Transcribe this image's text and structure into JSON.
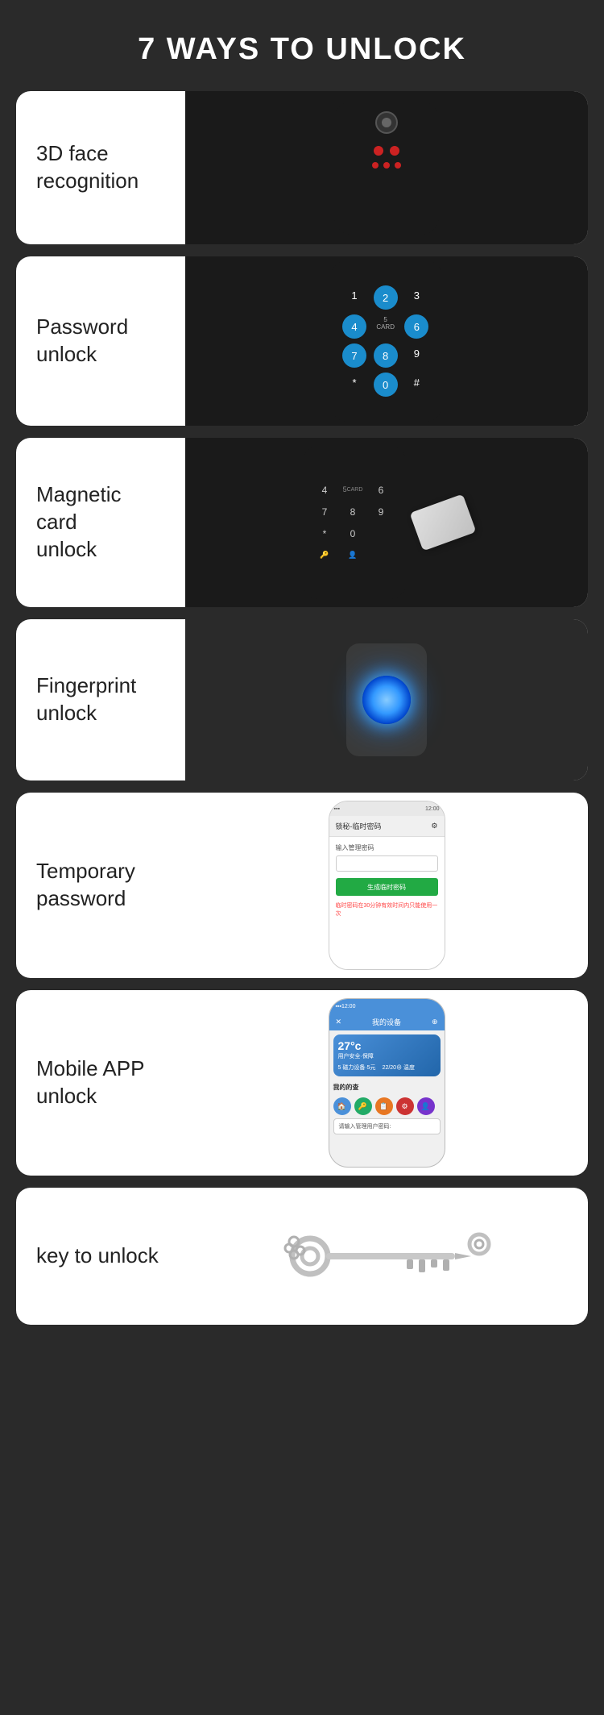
{
  "page": {
    "title": "7 WAYS TO UNLOCK",
    "background": "#2a2a2a"
  },
  "cards": [
    {
      "id": "face-recognition",
      "label": "3D face\nrecognition"
    },
    {
      "id": "password-unlock",
      "label": "Password\nunlock"
    },
    {
      "id": "magnetic-card",
      "label": "Magnetic card\nunlock"
    },
    {
      "id": "fingerprint",
      "label": "Fingerprint\nunlock"
    },
    {
      "id": "temporary-password",
      "label": "Temporary\npassword"
    },
    {
      "id": "mobile-app",
      "label": "Mobile APP\nunlock"
    },
    {
      "id": "key-unlock",
      "label": "key to unlock"
    }
  ],
  "keypad": {
    "keys": [
      "1",
      "2",
      "3",
      "4",
      "5",
      "6",
      "7",
      "8",
      "9",
      "*",
      "0",
      "#"
    ],
    "highlighted": [
      "2",
      "4",
      "6",
      "7",
      "8",
      "0"
    ],
    "card_label": "CARD"
  },
  "temp_app": {
    "header": "锁秘-临时密码",
    "input_label": "输入管理密码",
    "button": "生成临时密码",
    "note": "临时密码在30分钟有效时间内只能使用一次"
  },
  "mobile_app": {
    "header": "我的设备",
    "temp": "27°c",
    "sub": "用户安全·保障",
    "password_placeholder": "请输入管理用户密码:"
  }
}
